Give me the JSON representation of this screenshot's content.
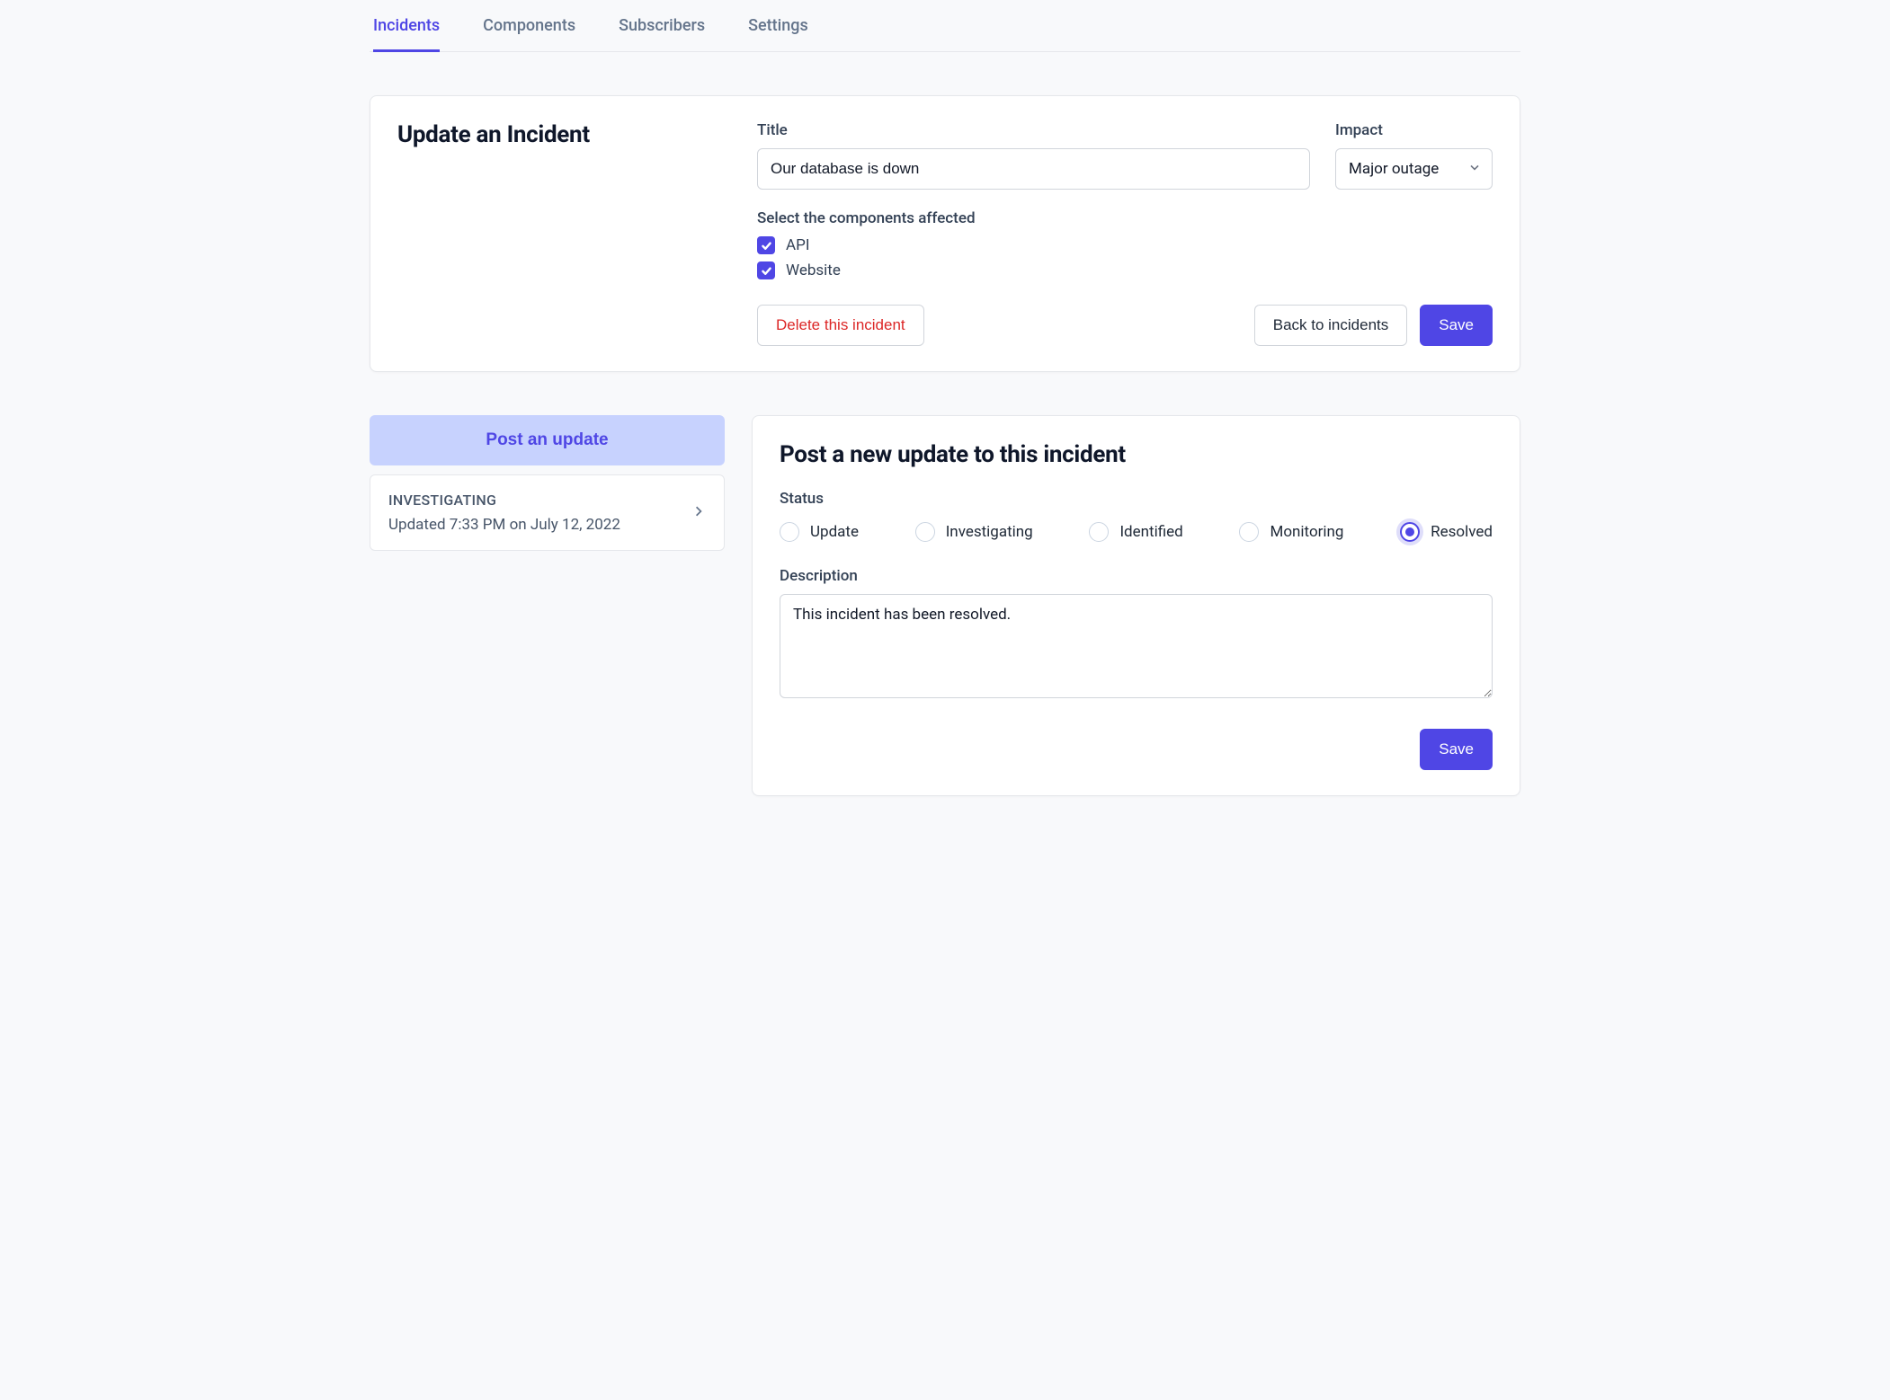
{
  "tabs": {
    "incidents": "Incidents",
    "components": "Components",
    "subscribers": "Subscribers",
    "settings": "Settings"
  },
  "update_incident": {
    "heading": "Update an Incident",
    "title_label": "Title",
    "title_value": "Our database is down",
    "impact_label": "Impact",
    "impact_value": "Major outage",
    "components_label": "Select the components affected",
    "components": [
      {
        "label": "API",
        "checked": true
      },
      {
        "label": "Website",
        "checked": true
      }
    ],
    "delete_btn": "Delete this incident",
    "back_btn": "Back to incidents",
    "save_btn": "Save"
  },
  "sidebar": {
    "post_update_btn": "Post an update",
    "updates": [
      {
        "status": "INVESTIGATING",
        "time": "Updated 7:33 PM on July 12, 2022"
      }
    ]
  },
  "new_update": {
    "heading": "Post a new update to this incident",
    "status_label": "Status",
    "statuses": [
      {
        "label": "Update",
        "selected": false
      },
      {
        "label": "Investigating",
        "selected": false
      },
      {
        "label": "Identified",
        "selected": false
      },
      {
        "label": "Monitoring",
        "selected": false
      },
      {
        "label": "Resolved",
        "selected": true
      }
    ],
    "description_label": "Description",
    "description_value": "This incident has been resolved.",
    "save_btn": "Save"
  }
}
